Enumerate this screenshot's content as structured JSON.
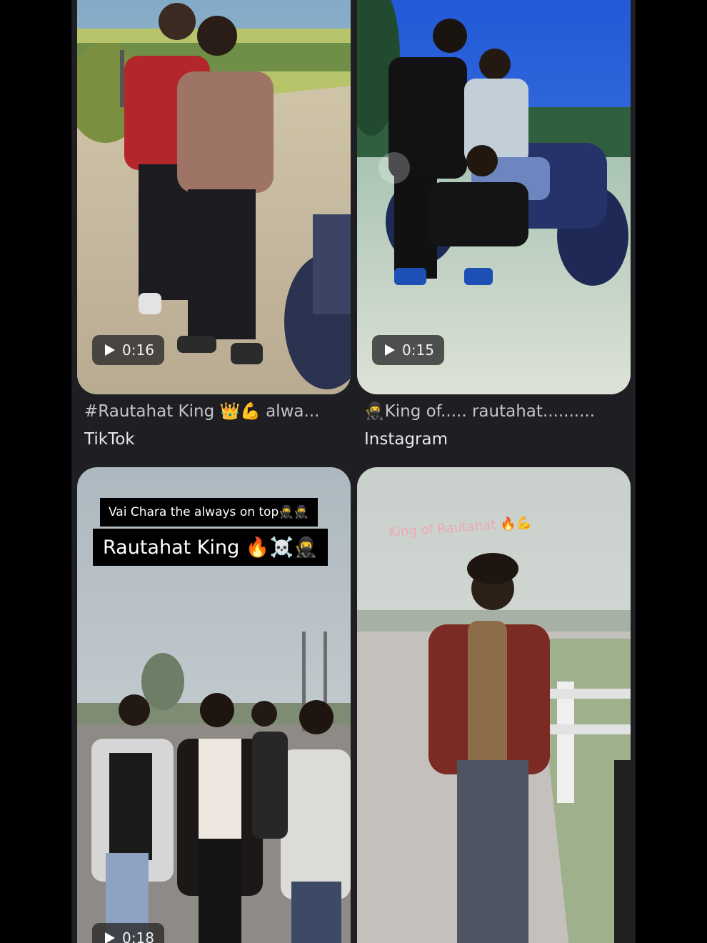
{
  "results": [
    {
      "duration": "0:16",
      "caption": "#Rautahat King 👑💪 alwa...",
      "source": "TikTok"
    },
    {
      "duration": "0:15",
      "caption": "🥷King of..... rautahat..........",
      "source": "Instagram"
    },
    {
      "overlay_line1": "Vai Chara the always on top🥷🥷",
      "overlay_line2": "Rautahat King 🔥☠️🥷",
      "duration": "0:18"
    },
    {
      "overlay_text": "King of Rautahat 🔥💪"
    }
  ]
}
